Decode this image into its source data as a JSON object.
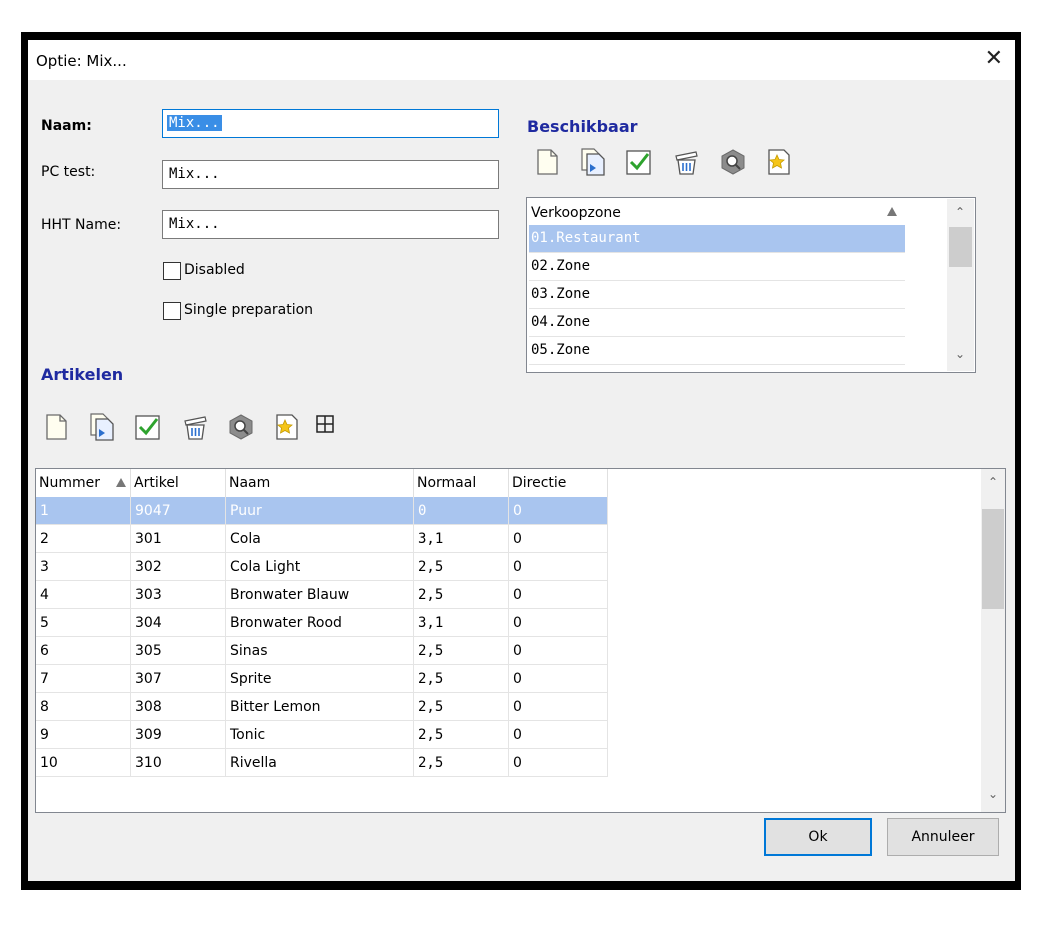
{
  "window": {
    "title": "Optie: Mix...",
    "close_glyph": "✕"
  },
  "form": {
    "naam_label": "Naam:",
    "naam_value": "Mix...",
    "pctest_label": "PC test:",
    "pctest_value": "Mix...",
    "hht_label": "HHT Name:",
    "hht_value": "Mix...",
    "disabled_label": "Disabled",
    "disabled_checked": false,
    "single_prep_label": "Single preparation",
    "single_prep_checked": false
  },
  "beschikbaar": {
    "title": "Beschikbaar",
    "toolbar_icons": [
      "new-icon",
      "copy-icon",
      "check-icon",
      "delete-icon",
      "search-icon",
      "star-icon"
    ],
    "column": "Verkoopzone",
    "items": [
      "01.Restaurant",
      "02.Zone",
      "03.Zone",
      "04.Zone",
      "05.Zone"
    ],
    "selected_index": 0
  },
  "artikelen": {
    "title": "Artikelen",
    "toolbar_icons": [
      "new-icon",
      "copy-icon",
      "check-icon",
      "delete-icon",
      "search-icon",
      "star-icon",
      "grid-icon"
    ],
    "columns": [
      "Nummer",
      "Artikel",
      "Naam",
      "Normaal",
      "Directie"
    ],
    "rows": [
      [
        "1",
        "9047",
        "Puur",
        "0",
        "0"
      ],
      [
        "2",
        "301",
        "Cola",
        "3,1",
        "0"
      ],
      [
        "3",
        "302",
        "Cola Light",
        "2,5",
        "0"
      ],
      [
        "4",
        "303",
        "Bronwater Blauw",
        "2,5",
        "0"
      ],
      [
        "5",
        "304",
        "Bronwater Rood",
        "3,1",
        "0"
      ],
      [
        "6",
        "305",
        "Sinas",
        "2,5",
        "0"
      ],
      [
        "7",
        "307",
        "Sprite",
        "2,5",
        "0"
      ],
      [
        "8",
        "308",
        "Bitter Lemon",
        "2,5",
        "0"
      ],
      [
        "9",
        "309",
        "Tonic",
        "2,5",
        "0"
      ],
      [
        "10",
        "310",
        "Rivella",
        "2,5",
        "0"
      ]
    ],
    "selected_index": 0
  },
  "buttons": {
    "ok": "Ok",
    "cancel": "Annuleer"
  },
  "colors": {
    "accent": "#0078d7",
    "section_title": "#1f2aa0",
    "selection": "#a9c5ef",
    "frame": "#000000"
  }
}
